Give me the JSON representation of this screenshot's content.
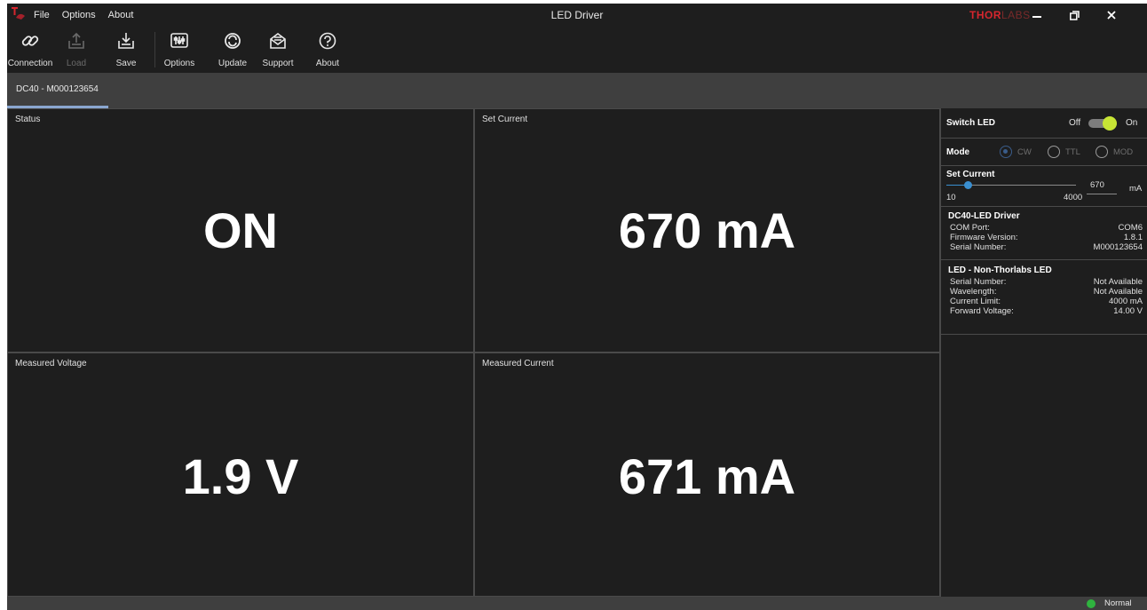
{
  "titlebar": {
    "menu": [
      "File",
      "Options",
      "About"
    ],
    "title": "LED Driver",
    "brand_strong": "THOR",
    "brand_light": "LABS"
  },
  "toolbar": {
    "items": [
      {
        "label": "Connection",
        "icon": "link-icon",
        "enabled": true
      },
      {
        "label": "Load",
        "icon": "upload-icon",
        "enabled": false
      },
      {
        "label": "Save",
        "icon": "download-icon",
        "enabled": true
      },
      {
        "label": "Options",
        "icon": "sliders-icon",
        "enabled": true
      },
      {
        "label": "Update",
        "icon": "refresh-icon",
        "enabled": true
      },
      {
        "label": "Support",
        "icon": "envelope-icon",
        "enabled": true
      },
      {
        "label": "About",
        "icon": "question-icon",
        "enabled": true
      }
    ]
  },
  "tab": {
    "label": "DC40 - M000123654"
  },
  "panels": {
    "status": {
      "label": "Status",
      "value": "ON"
    },
    "set_current": {
      "label": "Set Current",
      "value": "670 mA"
    },
    "measured_voltage": {
      "label": "Measured Voltage",
      "value": "1.9 V"
    },
    "measured_current": {
      "label": "Measured Current",
      "value": "671 mA"
    }
  },
  "sidebar": {
    "switch": {
      "label": "Switch LED",
      "off_label": "Off",
      "on_label": "On",
      "state": "on"
    },
    "mode": {
      "label": "Mode",
      "options": [
        "CW",
        "TTL",
        "MOD"
      ],
      "selected": "CW"
    },
    "set_current": {
      "label": "Set Current",
      "min": "10",
      "max": "4000",
      "value": "670",
      "unit": "mA",
      "level": 0.165
    },
    "driver": {
      "title": "DC40-LED Driver",
      "rows": [
        {
          "key": "COM Port:",
          "value": "COM6"
        },
        {
          "key": "Firmware Version:",
          "value": "1.8.1"
        },
        {
          "key": "Serial Number:",
          "value": "M000123654"
        }
      ]
    },
    "led": {
      "title": "LED - Non-Thorlabs LED",
      "rows": [
        {
          "key": "Serial Number:",
          "value": "Not Available"
        },
        {
          "key": "Wavelength:",
          "value": "Not Available"
        },
        {
          "key": "Current Limit:",
          "value": "4000 mA"
        },
        {
          "key": "Forward Voltage:",
          "value": "14.00 V"
        }
      ]
    }
  },
  "statusbar": {
    "text": "Normal",
    "led_color": "#2fb33f"
  },
  "colors": {
    "accent": "#3a8fd0",
    "toggle_on": "#c7e535",
    "brand_red": "#d6262e"
  }
}
